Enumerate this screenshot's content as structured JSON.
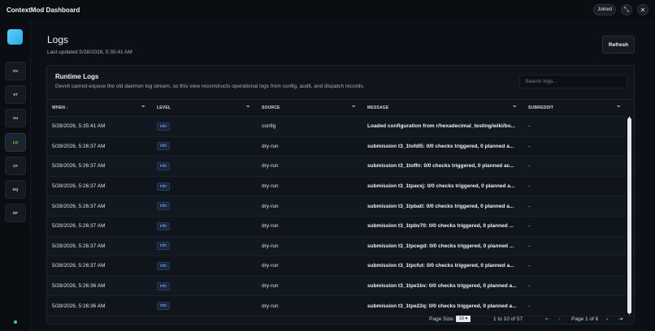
{
  "app": {
    "title": "ContextMod Dashboard"
  },
  "topbar": {
    "joined_label": "Joined",
    "expand_icon": "⤡",
    "close_icon": "✕"
  },
  "sidebar": {
    "items": [
      {
        "label": "OV"
      },
      {
        "label": "ST"
      },
      {
        "label": "AU"
      },
      {
        "label": "LG"
      },
      {
        "label": "CF"
      },
      {
        "label": "DQ"
      },
      {
        "label": "DF"
      }
    ],
    "active": "LG"
  },
  "page": {
    "title": "Logs",
    "last_updated": "Last updated 5/28/2026, 5:35:41 AM",
    "refresh_label": "Refresh"
  },
  "card": {
    "title": "Runtime Logs",
    "description": "Devvit cannot expose the old daemon log stream, so this view reconstructs operational logs from config, audit, and dispatch records.",
    "search_placeholder": "Search logs..."
  },
  "table": {
    "columns": [
      {
        "label": "WHEN ↓"
      },
      {
        "label": "LEVEL"
      },
      {
        "label": "SOURCE"
      },
      {
        "label": "MESSAGE"
      },
      {
        "label": "SUBREDDIT"
      }
    ],
    "rows": [
      {
        "when": "5/28/2026, 5:35:41 AM",
        "level": "info",
        "source": "config",
        "message": "Loaded configuration from r/hexadecimal_testing/wiki/bo...",
        "subreddit": "-"
      },
      {
        "when": "5/28/2026, 5:26:37 AM",
        "level": "info",
        "source": "dry-run",
        "message": "submission t3_1tofdl5: 0/0 checks triggered, 0 planned a...",
        "subreddit": "-"
      },
      {
        "when": "5/28/2026, 5:26:37 AM",
        "level": "info",
        "source": "dry-run",
        "message": "submission t3_1toffn: 0/0 checks triggered, 0 planned ac...",
        "subreddit": "-"
      },
      {
        "when": "5/28/2026, 5:26:37 AM",
        "level": "info",
        "source": "dry-run",
        "message": "submission t3_1tpavxj: 0/0 checks triggered, 0 planned a...",
        "subreddit": "-"
      },
      {
        "when": "5/28/2026, 5:26:37 AM",
        "level": "info",
        "source": "dry-run",
        "message": "submission t3_1tpbatl: 0/0 checks triggered, 0 planned a...",
        "subreddit": "-"
      },
      {
        "when": "5/28/2026, 5:26:37 AM",
        "level": "info",
        "source": "dry-run",
        "message": "submission t3_1tpbv70: 0/0 checks triggered, 0 planned ...",
        "subreddit": "-"
      },
      {
        "when": "5/28/2026, 5:26:37 AM",
        "level": "info",
        "source": "dry-run",
        "message": "submission t3_1tpcegd: 0/0 checks triggered, 0 planned ...",
        "subreddit": "-"
      },
      {
        "when": "5/28/2026, 5:26:37 AM",
        "level": "info",
        "source": "dry-run",
        "message": "submission t3_1tpcfut: 0/0 checks triggered, 0 planned a...",
        "subreddit": "-"
      },
      {
        "when": "5/28/2026, 5:26:36 AM",
        "level": "info",
        "source": "dry-run",
        "message": "submission t3_1tpe1bv: 0/0 checks triggered, 0 planned a...",
        "subreddit": "-"
      },
      {
        "when": "5/28/2026, 5:26:36 AM",
        "level": "info",
        "source": "dry-run",
        "message": "submission t3_1tpe22q: 0/0 checks triggered, 0 planned a...",
        "subreddit": "-"
      }
    ]
  },
  "pager": {
    "page_size_label": "Page Size:",
    "page_size": "10",
    "range": "1 to 10 of 57",
    "page": "Page 1 of 6",
    "first_icon": "⇤",
    "prev_icon": "‹",
    "next_icon": "›",
    "last_icon": "⇥"
  },
  "colors": {
    "accent": "#2ca8e6",
    "status_ok": "#3fd27a",
    "badge": "#8fb5ff"
  }
}
